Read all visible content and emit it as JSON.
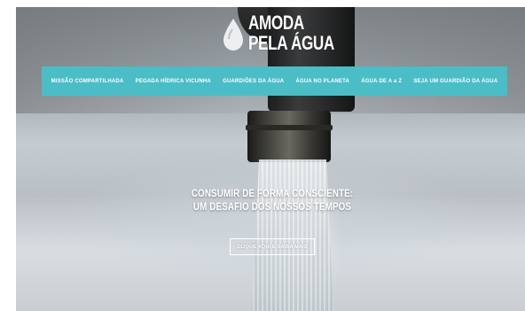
{
  "brand": {
    "line1": "AMODA",
    "line2": "PELA ÁGUA",
    "logo_icon": "water-drop-icon"
  },
  "nav": {
    "items": [
      {
        "label": "MISSÃO COMPARTILHADA"
      },
      {
        "label": "PEGADA HÍDRICA VICUNHA"
      },
      {
        "label": "GUARDIÕES DA ÁGUA"
      },
      {
        "label": "ÁGUA NO PLANETA"
      },
      {
        "label": "ÁGUA DE A a Z"
      },
      {
        "label": "SEJA UM GUARDIÃO DA ÁGUA"
      }
    ],
    "color": "#4bbdc6"
  },
  "hero": {
    "headline_line1": "CONSUMIR DE FORMA CONSCIENTE:",
    "headline_line2": "UM DESAFIO DOS NOSSOS TEMPOS",
    "cta_label": "CLIQUE AQUI E SAIBA MAIS"
  }
}
